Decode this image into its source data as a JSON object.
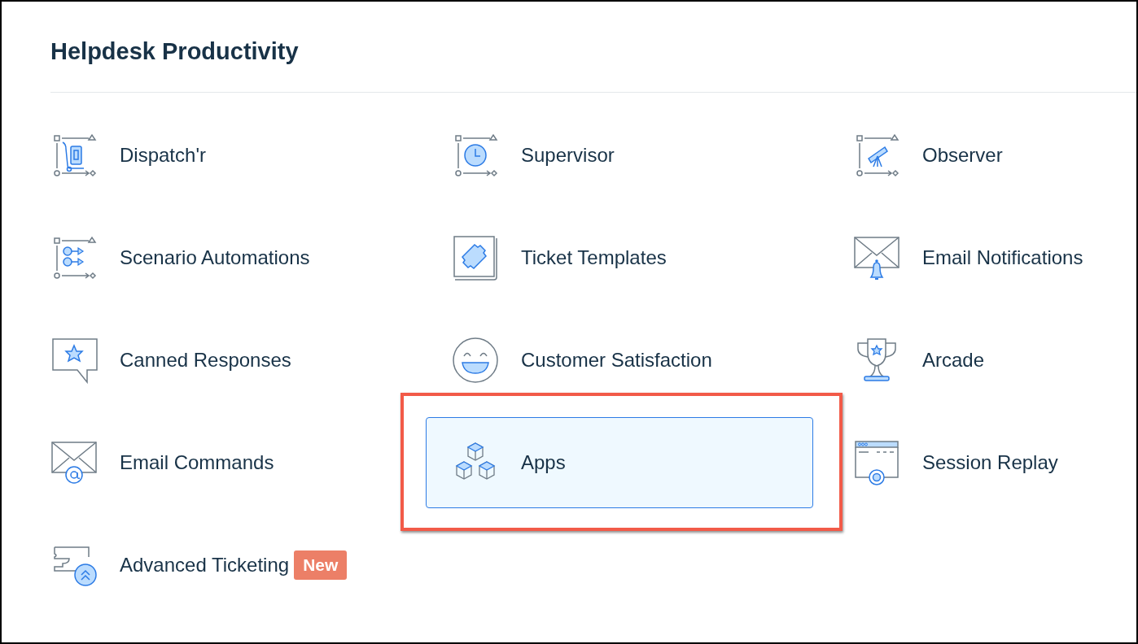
{
  "title": "Helpdesk Productivity",
  "items": [
    {
      "label": "Dispatch'r",
      "selected": false,
      "highlighted": false
    },
    {
      "label": "Supervisor",
      "selected": false,
      "highlighted": false
    },
    {
      "label": "Observer",
      "selected": false,
      "highlighted": false
    },
    {
      "label": "Scenario Automations",
      "selected": false,
      "highlighted": false
    },
    {
      "label": "Ticket Templates",
      "selected": false,
      "highlighted": false
    },
    {
      "label": "Email Notifications",
      "selected": false,
      "highlighted": false
    },
    {
      "label": "Canned Responses",
      "selected": false,
      "highlighted": false
    },
    {
      "label": "Customer Satisfaction",
      "selected": false,
      "highlighted": false
    },
    {
      "label": "Arcade",
      "selected": false,
      "highlighted": false
    },
    {
      "label": "Email Commands",
      "selected": false,
      "highlighted": false
    },
    {
      "label": "Apps",
      "selected": true,
      "highlighted": true
    },
    {
      "label": "Session Replay",
      "selected": false,
      "highlighted": false
    },
    {
      "label": "Advanced Ticketing",
      "selected": false,
      "highlighted": false,
      "badge": "New"
    }
  ]
}
